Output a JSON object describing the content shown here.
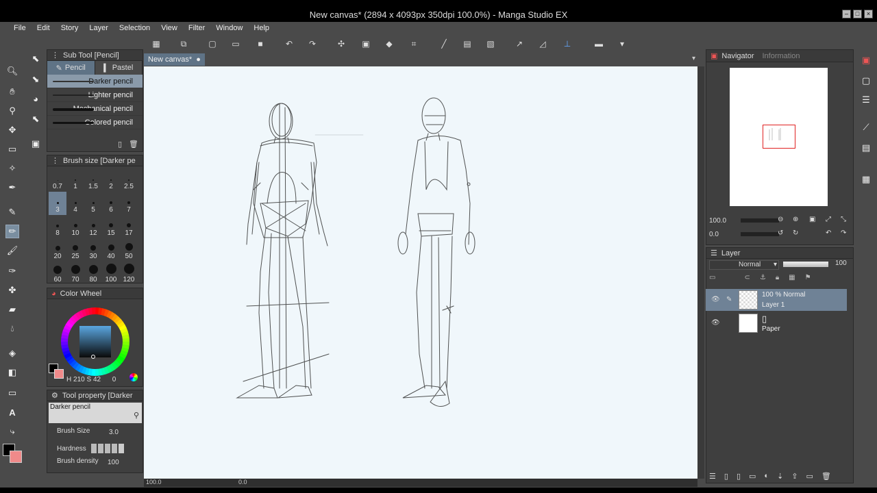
{
  "window": {
    "title": "New canvas* (2894 x 4093px 350dpi 100.0%) - Manga Studio EX"
  },
  "menu": [
    "File",
    "Edit",
    "Story",
    "Layer",
    "Selection",
    "View",
    "Filter",
    "Window",
    "Help"
  ],
  "sub_tool": {
    "title": "Sub Tool [Pencil]",
    "tabs": [
      "Pencil",
      "Pastel"
    ],
    "items": [
      "Darker pencil",
      "Lighter pencil",
      "Mechanical pencil",
      "Colored pencil"
    ],
    "selected_index": 0
  },
  "brush_size": {
    "title": "Brush size [Darker pe",
    "values": [
      "0.7",
      "1",
      "1.5",
      "2",
      "2.5",
      "3",
      "4",
      "5",
      "6",
      "7",
      "8",
      "10",
      "12",
      "15",
      "17",
      "20",
      "25",
      "30",
      "40",
      "50",
      "60",
      "70",
      "80",
      "100",
      "120"
    ],
    "selected": "3"
  },
  "color_wheel": {
    "title": "Color Wheel",
    "h": "210",
    "s": "42",
    "v": "0",
    "main_color": "#000000",
    "sub_color": "#f08a8a"
  },
  "tool_property": {
    "title": "Tool property [Darker",
    "name": "Darker pencil",
    "brush_size_label": "Brush Size",
    "brush_size_value": "3.0",
    "hardness_label": "Hardness",
    "density_label": "Brush density",
    "density_value": "100"
  },
  "canvas": {
    "tab_label": "New canvas*",
    "zoom": "100.0",
    "angle": "0.0"
  },
  "navigator": {
    "tabs": [
      "Navigator",
      "Information"
    ],
    "zoom": "100.0",
    "rotation": "0.0"
  },
  "layer": {
    "title": "Layer",
    "blend_mode": "Normal",
    "opacity": "100",
    "rows": [
      {
        "top": "100 %  Normal",
        "name": "Layer 1",
        "selected": true
      },
      {
        "top": "",
        "name": "Paper",
        "selected": false
      }
    ]
  }
}
